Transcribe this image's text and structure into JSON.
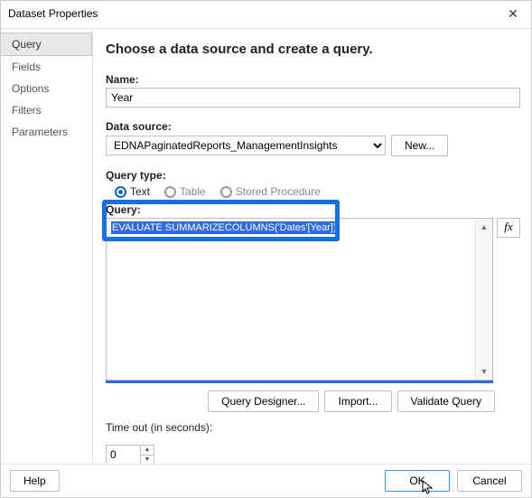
{
  "window": {
    "title": "Dataset Properties"
  },
  "sidebar": {
    "items": [
      {
        "label": "Query",
        "active": true
      },
      {
        "label": "Fields"
      },
      {
        "label": "Options"
      },
      {
        "label": "Filters"
      },
      {
        "label": "Parameters"
      }
    ]
  },
  "main": {
    "heading": "Choose a data source and create a query.",
    "name_label": "Name:",
    "name_value": "Year",
    "datasource_label": "Data source:",
    "datasource_value": "EDNAPaginatedReports_ManagementInsights",
    "new_btn": "New...",
    "querytype_label": "Query type:",
    "querytype_options": [
      "Text",
      "Table",
      "Stored Procedure"
    ],
    "querytype_selected": 0,
    "query_label": "Query:",
    "query_value": "EVALUATE SUMMARIZECOLUMNS('Dates'[Year])",
    "fx_label": "fx",
    "query_designer_btn": "Query Designer...",
    "import_btn": "Import...",
    "validate_btn": "Validate Query",
    "timeout_label": "Time out (in seconds):",
    "timeout_value": "0"
  },
  "footer": {
    "help": "Help",
    "ok": "OK",
    "cancel": "Cancel"
  }
}
